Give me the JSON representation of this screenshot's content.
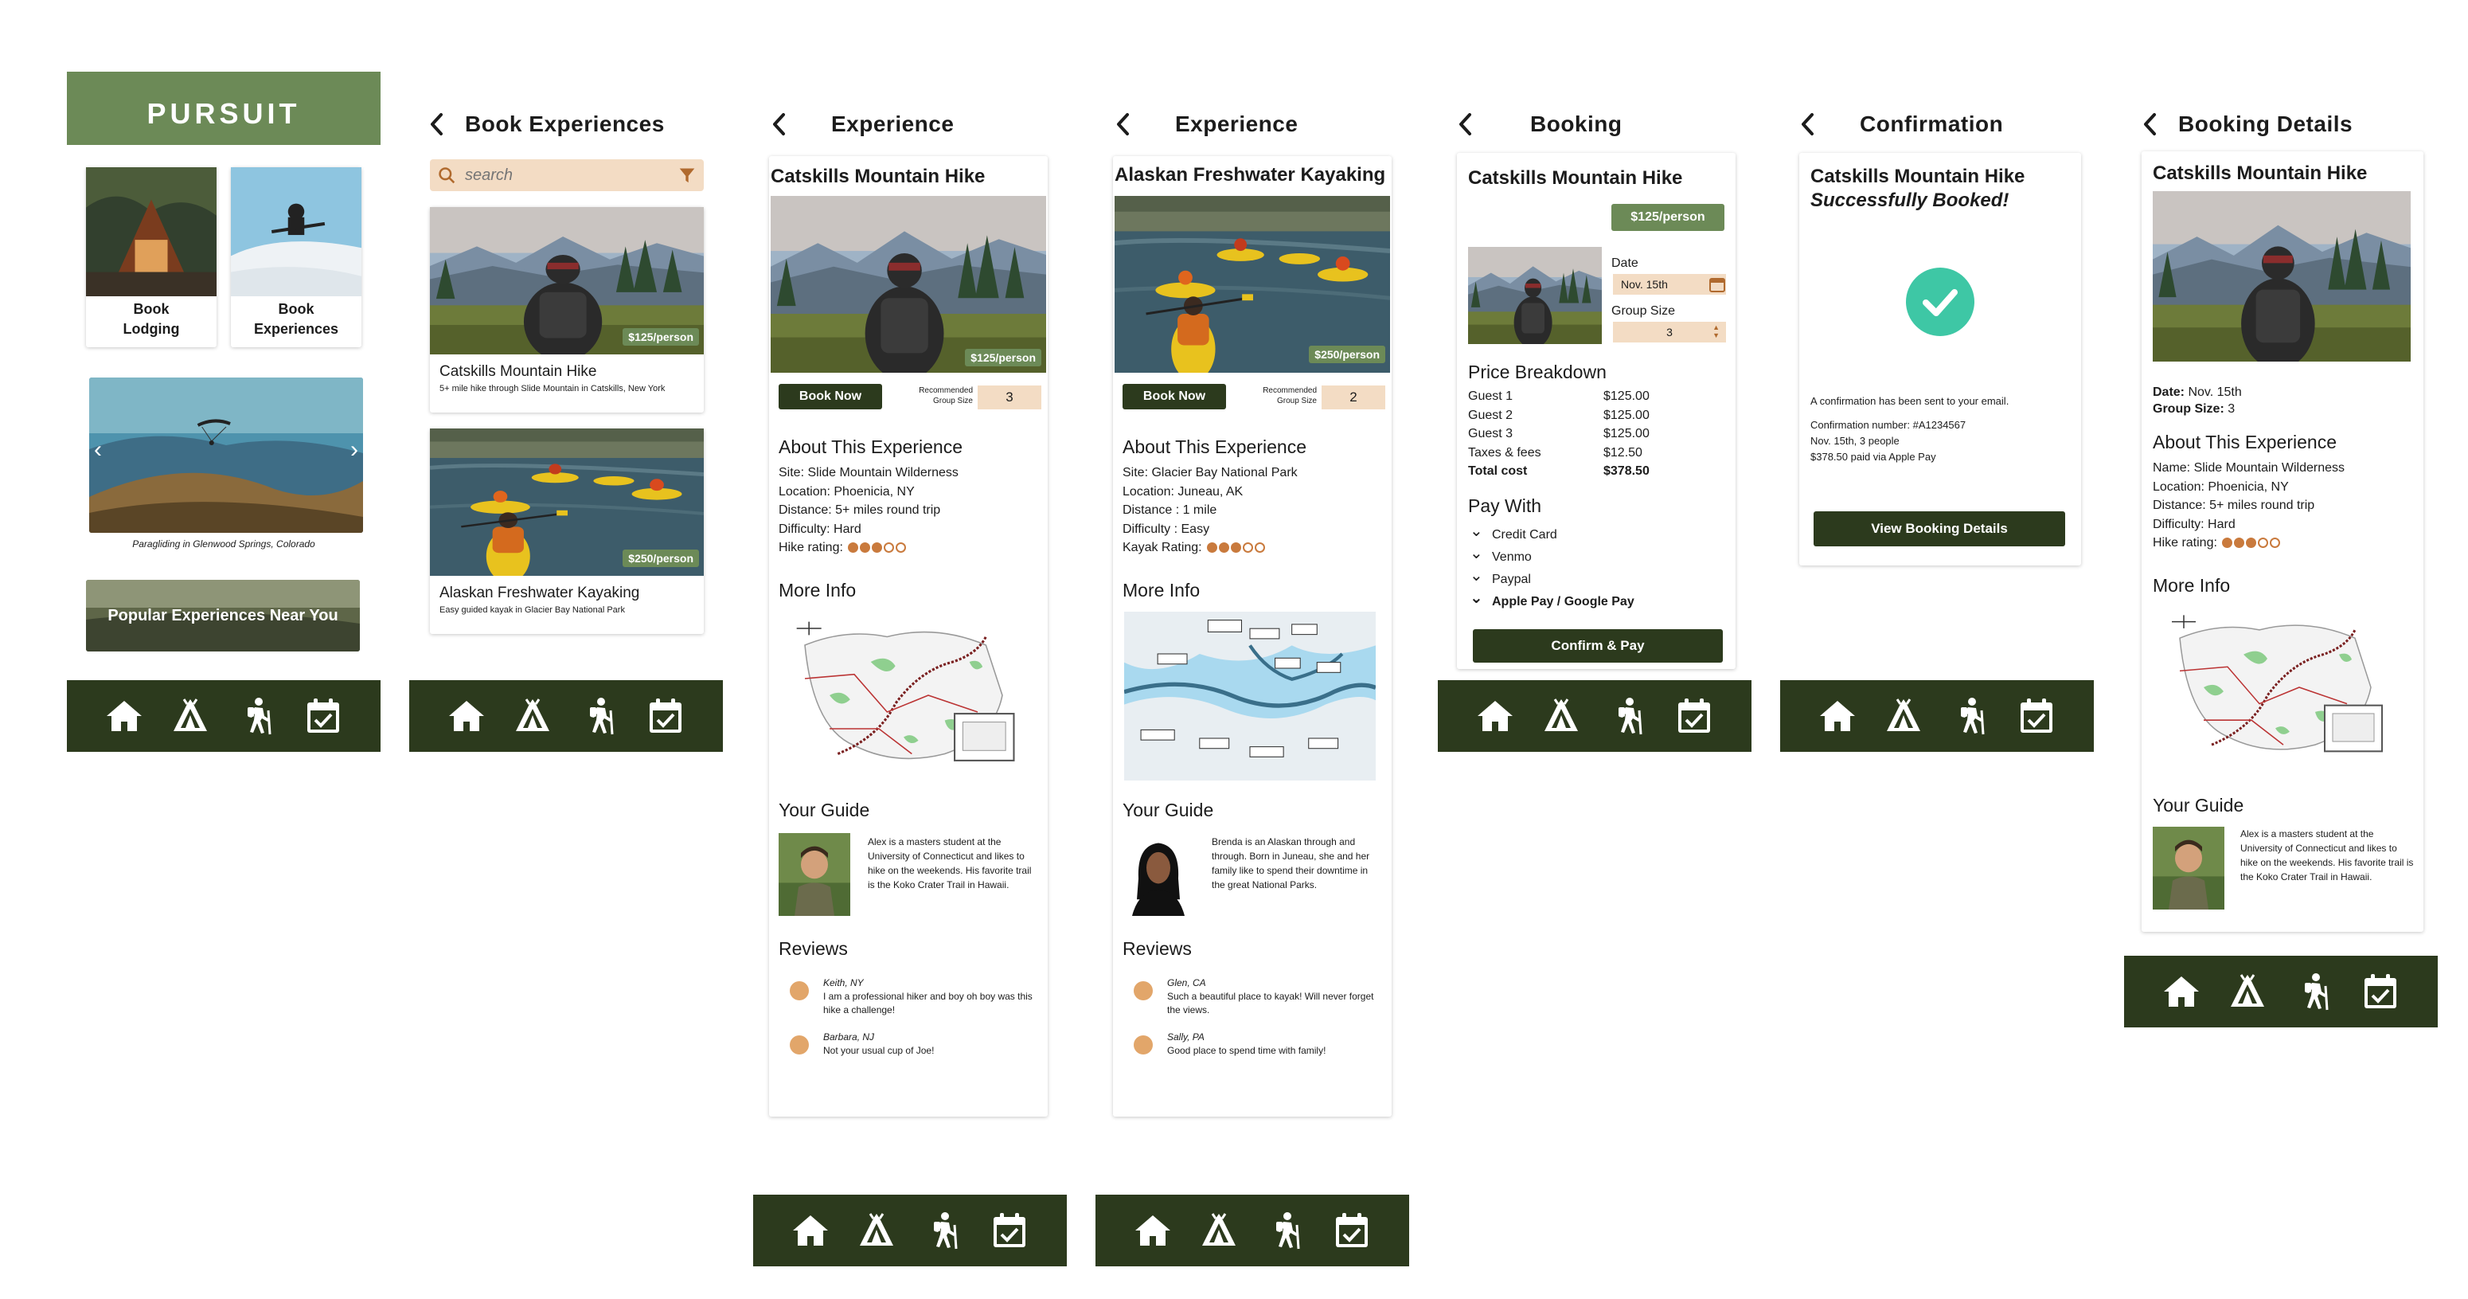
{
  "home": {
    "brand": "PURSUIT",
    "tile_lodging": "Book\nLodging",
    "tile_experiences": "Book\nExperiences",
    "carousel_caption": "Paragliding in Glenwood Springs, Colorado",
    "popular_banner": "Popular Experiences Near You"
  },
  "book_experiences": {
    "title": "Book Experiences",
    "search_placeholder": "search",
    "items": [
      {
        "name": "Catskills Mountain Hike",
        "desc": "5+ mile hike through Slide Mountain in Catskills, New York",
        "price": "$125/person"
      },
      {
        "name": "Alaskan Freshwater Kayaking",
        "desc": "Easy guided kayak in Glacier Bay National Park",
        "price": "$250/person"
      }
    ]
  },
  "exp_hike": {
    "title": "Experience",
    "name": "Catskills Mountain Hike",
    "price": "$125/person",
    "book_now": "Book Now",
    "rec_group": "Recommended\nGroup Size",
    "group_value": "3",
    "about_title": "About This Experience",
    "site": "Site: Slide Mountain Wilderness",
    "location": "Location: Phoenicia, NY",
    "distance": "Distance: 5+ miles round trip",
    "difficulty": "Difficulty: Hard",
    "rating_label": "Hike rating:",
    "rating": 3,
    "more_info": "More Info",
    "guide_title": "Your Guide",
    "guide_bio": "Alex is a masters student at the University of Connecticut and likes to hike on the weekends. His favorite trail is the Koko Crater Trail in Hawaii.",
    "reviews_title": "Reviews",
    "reviews": [
      {
        "name": "Keith, NY",
        "text": "I am a professional hiker and boy oh boy was this hike a challenge!"
      },
      {
        "name": "Barbara, NJ",
        "text": "Not your usual cup of Joe!"
      }
    ]
  },
  "exp_kayak": {
    "title": "Experience",
    "name": "Alaskan Freshwater Kayaking",
    "price": "$250/person",
    "book_now": "Book Now",
    "rec_group": "Recommended\nGroup Size",
    "group_value": "2",
    "about_title": "About This Experience",
    "site": "Site: Glacier Bay National Park",
    "location": "Location: Juneau, AK",
    "distance": "Distance : 1 mile",
    "difficulty": "Difficulty : Easy",
    "rating_label": "Kayak Rating:",
    "rating": 3,
    "more_info": "More Info",
    "guide_title": "Your Guide",
    "guide_bio": "Brenda is an Alaskan through and through. Born in Juneau, she and her family like to spend their downtime in the great National Parks.",
    "reviews_title": "Reviews",
    "reviews": [
      {
        "name": "Glen, CA",
        "text": "Such a beautiful place to kayak! Will never forget the views."
      },
      {
        "name": "Sally, PA",
        "text": "Good place to spend time with family!"
      }
    ]
  },
  "booking": {
    "title": "Booking",
    "name": "Catskills Mountain Hike",
    "price": "$125/person",
    "date_label": "Date",
    "date_value": "Nov. 15th",
    "group_label": "Group Size",
    "group_value": "3",
    "breakdown_title": "Price Breakdown",
    "lines": [
      {
        "label": "Guest 1",
        "value": "$125.00"
      },
      {
        "label": "Guest 2",
        "value": "$125.00"
      },
      {
        "label": "Guest 3",
        "value": "$125.00"
      },
      {
        "label": "Taxes & fees",
        "value": "$12.50"
      }
    ],
    "total_label": "Total cost",
    "total_value": "$378.50",
    "pay_title": "Pay With",
    "pay_options": [
      "Credit Card",
      "Venmo",
      "Paypal",
      "Apple Pay / Google Pay"
    ],
    "confirm": "Confirm & Pay"
  },
  "confirmation": {
    "title": "Confirmation",
    "name": "Catskills Mountain Hike",
    "subtitle": "Successfully Booked!",
    "sent": "A confirmation has been sent to your email.",
    "conf_number": "Confirmation number: #A1234567",
    "details": "Nov. 15th, 3 people",
    "paid": "$378.50 paid via Apple Pay",
    "view_button": "View Booking Details"
  },
  "booking_details": {
    "title": "Booking Details",
    "name": "Catskills Mountain Hike",
    "date_label": "Date:",
    "date_value": " Nov. 15th",
    "group_label": "Group Size:",
    "group_value": " 3",
    "about_title": "About This Experience",
    "site": "Name: Slide Mountain Wilderness",
    "location": "Location: Phoenicia, NY",
    "distance": "Distance: 5+ miles round trip",
    "difficulty": "Difficulty: Hard",
    "rating_label": "Hike rating:",
    "rating": 3,
    "more_info": "More Info",
    "guide_title": "Your Guide",
    "guide_bio": "Alex is a masters student at the University of Connecticut and likes to hike on the weekends. His favorite trail is the Koko Crater Trail in Hawaii."
  },
  "nav_icons": [
    "home-icon",
    "tent-icon",
    "hiker-icon",
    "calendar-check-icon"
  ],
  "colors": {
    "dark_green": "#2c3a1d",
    "brand_green": "#6c8a57",
    "peach": "#f3dcc4",
    "accent_orange": "#c97a3d",
    "check_teal": "#3ec7a5"
  }
}
